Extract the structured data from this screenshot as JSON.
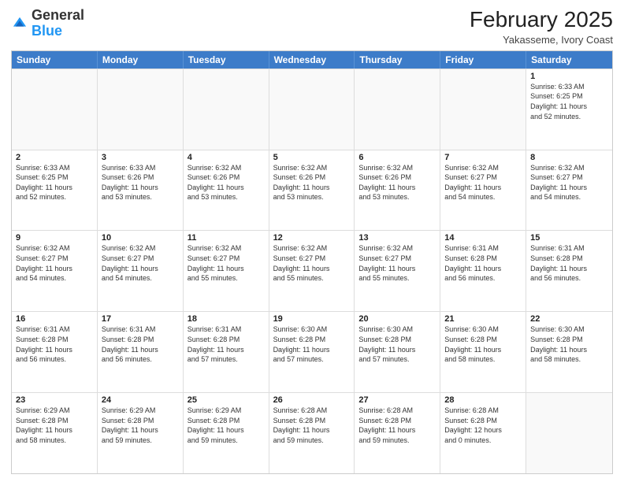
{
  "header": {
    "logo_general": "General",
    "logo_blue": "Blue",
    "month_year": "February 2025",
    "location": "Yakasseme, Ivory Coast"
  },
  "weekdays": [
    "Sunday",
    "Monday",
    "Tuesday",
    "Wednesday",
    "Thursday",
    "Friday",
    "Saturday"
  ],
  "rows": [
    [
      {
        "day": "",
        "info": ""
      },
      {
        "day": "",
        "info": ""
      },
      {
        "day": "",
        "info": ""
      },
      {
        "day": "",
        "info": ""
      },
      {
        "day": "",
        "info": ""
      },
      {
        "day": "",
        "info": ""
      },
      {
        "day": "1",
        "info": "Sunrise: 6:33 AM\nSunset: 6:25 PM\nDaylight: 11 hours\nand 52 minutes."
      }
    ],
    [
      {
        "day": "2",
        "info": "Sunrise: 6:33 AM\nSunset: 6:25 PM\nDaylight: 11 hours\nand 52 minutes."
      },
      {
        "day": "3",
        "info": "Sunrise: 6:33 AM\nSunset: 6:26 PM\nDaylight: 11 hours\nand 53 minutes."
      },
      {
        "day": "4",
        "info": "Sunrise: 6:32 AM\nSunset: 6:26 PM\nDaylight: 11 hours\nand 53 minutes."
      },
      {
        "day": "5",
        "info": "Sunrise: 6:32 AM\nSunset: 6:26 PM\nDaylight: 11 hours\nand 53 minutes."
      },
      {
        "day": "6",
        "info": "Sunrise: 6:32 AM\nSunset: 6:26 PM\nDaylight: 11 hours\nand 53 minutes."
      },
      {
        "day": "7",
        "info": "Sunrise: 6:32 AM\nSunset: 6:27 PM\nDaylight: 11 hours\nand 54 minutes."
      },
      {
        "day": "8",
        "info": "Sunrise: 6:32 AM\nSunset: 6:27 PM\nDaylight: 11 hours\nand 54 minutes."
      }
    ],
    [
      {
        "day": "9",
        "info": "Sunrise: 6:32 AM\nSunset: 6:27 PM\nDaylight: 11 hours\nand 54 minutes."
      },
      {
        "day": "10",
        "info": "Sunrise: 6:32 AM\nSunset: 6:27 PM\nDaylight: 11 hours\nand 54 minutes."
      },
      {
        "day": "11",
        "info": "Sunrise: 6:32 AM\nSunset: 6:27 PM\nDaylight: 11 hours\nand 55 minutes."
      },
      {
        "day": "12",
        "info": "Sunrise: 6:32 AM\nSunset: 6:27 PM\nDaylight: 11 hours\nand 55 minutes."
      },
      {
        "day": "13",
        "info": "Sunrise: 6:32 AM\nSunset: 6:27 PM\nDaylight: 11 hours\nand 55 minutes."
      },
      {
        "day": "14",
        "info": "Sunrise: 6:31 AM\nSunset: 6:28 PM\nDaylight: 11 hours\nand 56 minutes."
      },
      {
        "day": "15",
        "info": "Sunrise: 6:31 AM\nSunset: 6:28 PM\nDaylight: 11 hours\nand 56 minutes."
      }
    ],
    [
      {
        "day": "16",
        "info": "Sunrise: 6:31 AM\nSunset: 6:28 PM\nDaylight: 11 hours\nand 56 minutes."
      },
      {
        "day": "17",
        "info": "Sunrise: 6:31 AM\nSunset: 6:28 PM\nDaylight: 11 hours\nand 56 minutes."
      },
      {
        "day": "18",
        "info": "Sunrise: 6:31 AM\nSunset: 6:28 PM\nDaylight: 11 hours\nand 57 minutes."
      },
      {
        "day": "19",
        "info": "Sunrise: 6:30 AM\nSunset: 6:28 PM\nDaylight: 11 hours\nand 57 minutes."
      },
      {
        "day": "20",
        "info": "Sunrise: 6:30 AM\nSunset: 6:28 PM\nDaylight: 11 hours\nand 57 minutes."
      },
      {
        "day": "21",
        "info": "Sunrise: 6:30 AM\nSunset: 6:28 PM\nDaylight: 11 hours\nand 58 minutes."
      },
      {
        "day": "22",
        "info": "Sunrise: 6:30 AM\nSunset: 6:28 PM\nDaylight: 11 hours\nand 58 minutes."
      }
    ],
    [
      {
        "day": "23",
        "info": "Sunrise: 6:29 AM\nSunset: 6:28 PM\nDaylight: 11 hours\nand 58 minutes."
      },
      {
        "day": "24",
        "info": "Sunrise: 6:29 AM\nSunset: 6:28 PM\nDaylight: 11 hours\nand 59 minutes."
      },
      {
        "day": "25",
        "info": "Sunrise: 6:29 AM\nSunset: 6:28 PM\nDaylight: 11 hours\nand 59 minutes."
      },
      {
        "day": "26",
        "info": "Sunrise: 6:28 AM\nSunset: 6:28 PM\nDaylight: 11 hours\nand 59 minutes."
      },
      {
        "day": "27",
        "info": "Sunrise: 6:28 AM\nSunset: 6:28 PM\nDaylight: 11 hours\nand 59 minutes."
      },
      {
        "day": "28",
        "info": "Sunrise: 6:28 AM\nSunset: 6:28 PM\nDaylight: 12 hours\nand 0 minutes."
      },
      {
        "day": "",
        "info": ""
      }
    ]
  ]
}
